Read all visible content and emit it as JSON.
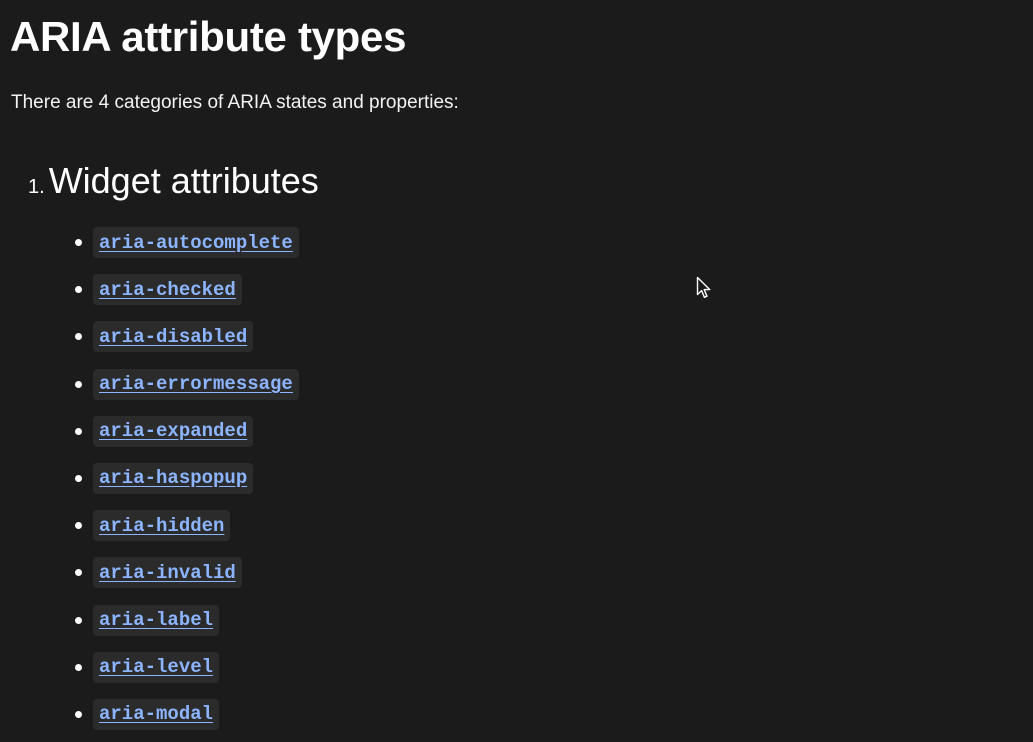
{
  "page": {
    "title": "ARIA attribute types",
    "intro": "There are 4 categories of ARIA states and properties:"
  },
  "sections": [
    {
      "number": "1.",
      "title": "Widget attributes",
      "items": [
        "aria-autocomplete",
        "aria-checked",
        "aria-disabled",
        "aria-errormessage",
        "aria-expanded",
        "aria-haspopup",
        "aria-hidden",
        "aria-invalid",
        "aria-label",
        "aria-level",
        "aria-modal"
      ]
    }
  ],
  "colors": {
    "background": "#1b1b1b",
    "text": "#ffffff",
    "link": "#8cb4ff",
    "code_background": "#2b2b2b"
  },
  "icons": {
    "cursor": "mouse-pointer-icon",
    "bullet": "bullet-dot"
  }
}
